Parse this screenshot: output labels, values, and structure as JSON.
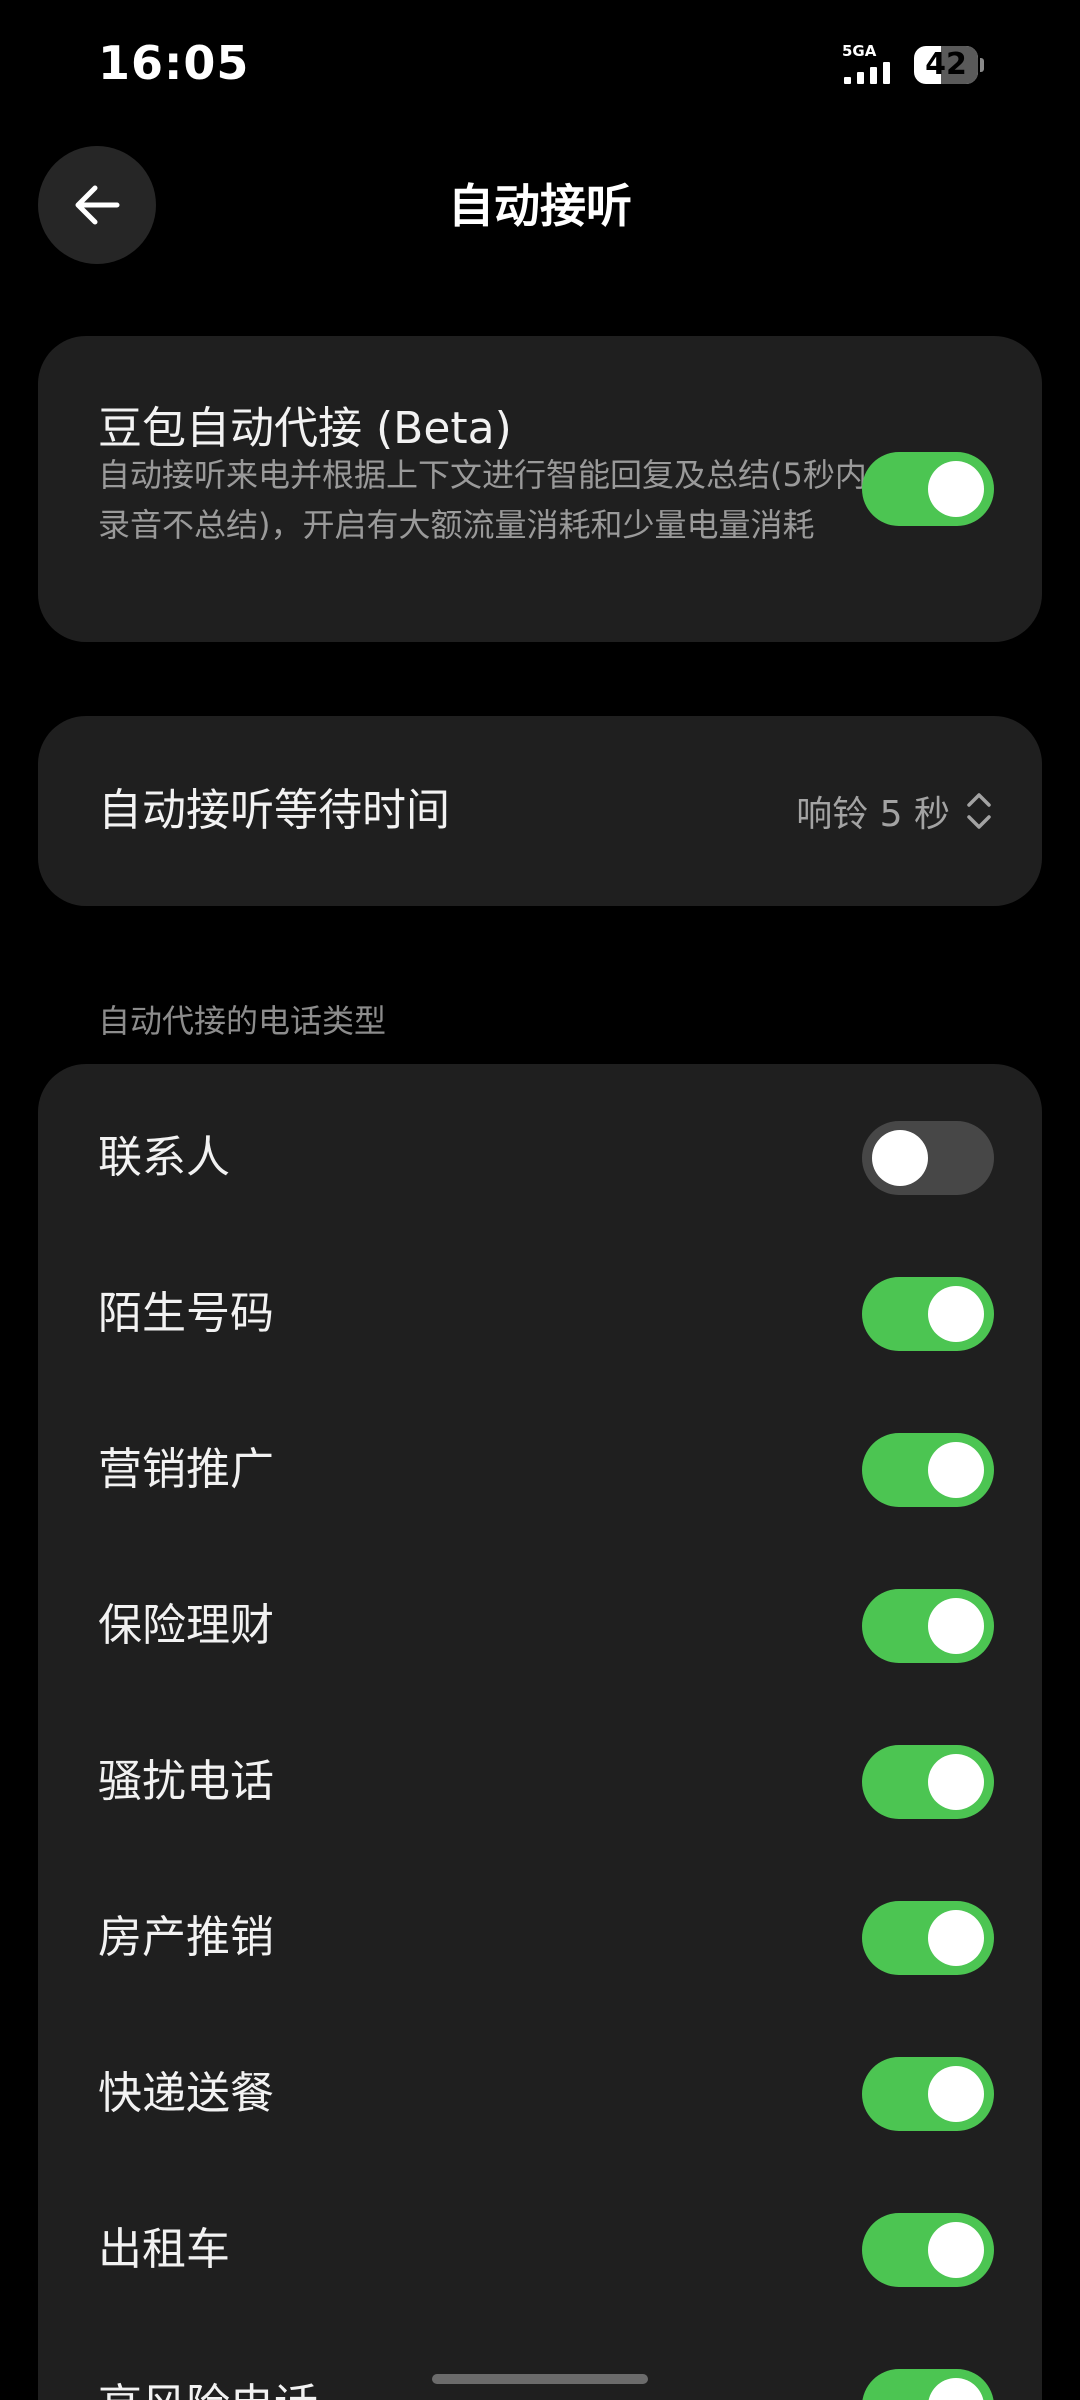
{
  "status_bar": {
    "time": "16:05",
    "network_label": "5GA",
    "signal_level": 4,
    "battery_level": 42,
    "battery_text": "42"
  },
  "header": {
    "back_icon": "arrow-left-icon",
    "title": "自动接听"
  },
  "main_setting": {
    "title": "豆包自动代接 (Beta)",
    "description": "自动接听来电并根据上下文进行智能回复及总结(5秒内录音不总结)，开启有大额流量消耗和少量电量消耗",
    "enabled": true
  },
  "wait_time": {
    "label": "自动接听等待时间",
    "value": "响铃 5 秒",
    "icon": "chevron-up-down-icon"
  },
  "call_types": {
    "section_label": "自动代接的电话类型",
    "items": [
      {
        "label": "联系人",
        "enabled": false
      },
      {
        "label": "陌生号码",
        "enabled": true
      },
      {
        "label": "营销推广",
        "enabled": true
      },
      {
        "label": "保险理财",
        "enabled": true
      },
      {
        "label": "骚扰电话",
        "enabled": true
      },
      {
        "label": "房产推销",
        "enabled": true
      },
      {
        "label": "快递送餐",
        "enabled": true
      },
      {
        "label": "出租车",
        "enabled": true
      },
      {
        "label": "高风险电话",
        "enabled": true
      }
    ]
  },
  "colors": {
    "background": "#000000",
    "card": "#1f1f1f",
    "toggle_on": "#4cc552",
    "toggle_off": "#474747"
  }
}
